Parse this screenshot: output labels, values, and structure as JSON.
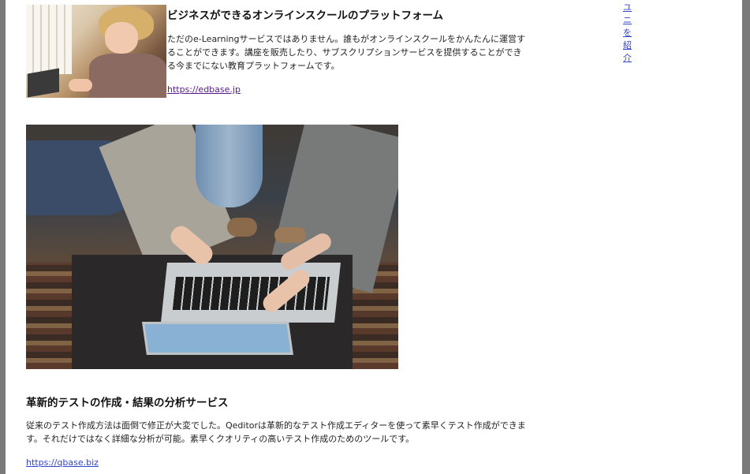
{
  "services": [
    {
      "title": "ビジネスができるオンラインスクールのプラットフォーム",
      "description": "ただのe-Learningサービスではありません。誰もがオンラインスクールをかんたんに運営することができます。講座を販売したり、サブスクリプションサービスを提供することができる今までにない教育プラットフォームです。",
      "link": "https://edbase.jp",
      "image_alt": "タブレットを使う子ども"
    },
    {
      "title": "革新的テストの作成・結果の分析サービス",
      "description": "従来のテスト作成方法は面倒で修正が大変でした。Qeditorは革新的なテスト作成エディターを使って素早くテスト作成ができます。それだけではなく詳細な分析が可能。素早くクオリティの高いテスト作成のためのツールです。",
      "link": "https://qbase.biz",
      "image_alt": "ノートパソコンを指さす人々"
    }
  ],
  "side_link": "ユニを紹介",
  "colors": {
    "frame": "#7a7a7a",
    "link": "#3344cc",
    "visited": "#551a8b"
  }
}
